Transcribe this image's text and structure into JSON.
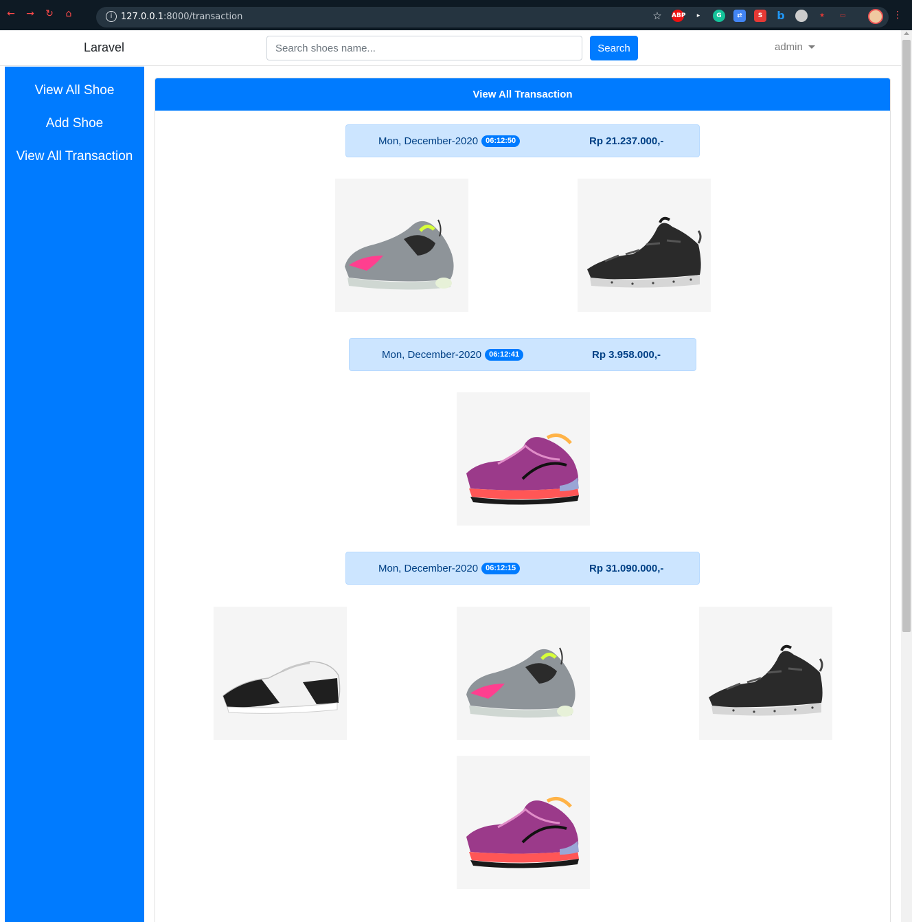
{
  "browser": {
    "url_host": "127.0.0.1",
    "url_path": ":8000/transaction",
    "extensions": [
      "ABP",
      "G",
      "S",
      "b"
    ]
  },
  "navbar": {
    "brand": "Laravel",
    "search_placeholder": "Search shoes name...",
    "search_button": "Search",
    "user": "admin"
  },
  "sidebar": {
    "items": [
      {
        "label": "View All Shoe"
      },
      {
        "label": "Add Shoe"
      },
      {
        "label": "View All Transaction"
      }
    ]
  },
  "main": {
    "title": "View All Transaction",
    "transactions": [
      {
        "date": "Mon, December-2020",
        "time": "06:12:50",
        "total": "Rp 21.237.000,-",
        "shoes": [
          "pink-grey-sneaker",
          "black-speckled-sneaker"
        ]
      },
      {
        "date": "Mon, December-2020",
        "time": "06:12:41",
        "total": "Rp 3.958.000,-",
        "shoes": [
          "purple-pattern-sneaker"
        ]
      },
      {
        "date": "Mon, December-2020",
        "time": "06:12:15",
        "total": "Rp 31.090.000,-",
        "shoes": [
          "black-white-sneaker",
          "pink-grey-sneaker",
          "black-speckled-sneaker",
          "purple-pattern-sneaker"
        ]
      }
    ]
  }
}
